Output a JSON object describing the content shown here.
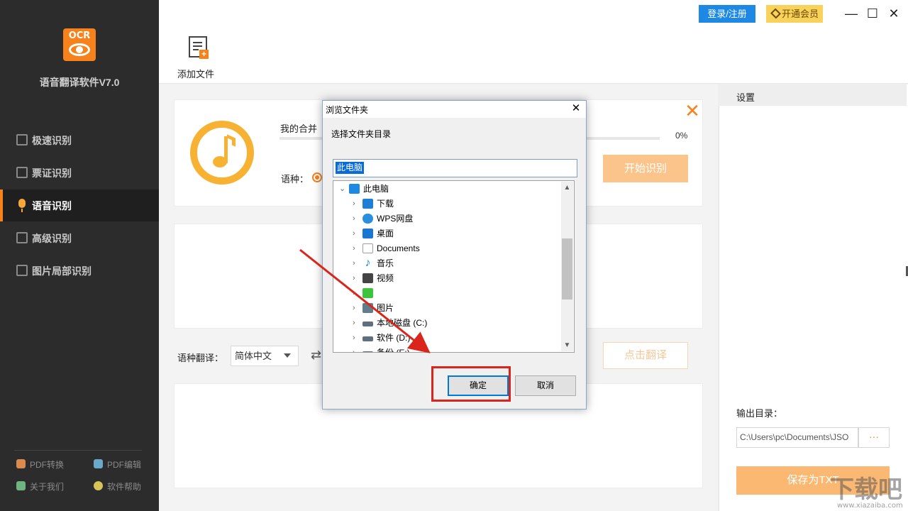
{
  "app": {
    "logo_text": "OCR",
    "title": "语音翻译软件V7.0"
  },
  "sidebar": {
    "items": [
      {
        "label": "极速识别",
        "active": false
      },
      {
        "label": "票证识别",
        "active": false
      },
      {
        "label": "语音识别",
        "active": true
      },
      {
        "label": "高级识别",
        "active": false
      },
      {
        "label": "图片局部识别",
        "active": false
      }
    ],
    "footer_links": [
      {
        "label": "PDF转换",
        "icon": "pdf-convert-icon",
        "color": "#d98a4e"
      },
      {
        "label": "PDF编辑",
        "icon": "pdf-edit-icon",
        "color": "#6aa9c9"
      },
      {
        "label": "关于我们",
        "icon": "about-icon",
        "color": "#6fb57f"
      },
      {
        "label": "软件帮助",
        "icon": "help-icon",
        "color": "#d7c35a"
      }
    ]
  },
  "topbar": {
    "login_label": "登录/注册",
    "vip_label": "开通会员",
    "minimize": "—",
    "maximize": "☐",
    "close": "✕"
  },
  "toolbar": {
    "add_file_label": "添加文件"
  },
  "main": {
    "file_name": "我的合并",
    "progress_pct": "0%",
    "progress_value": 0,
    "language_label": "语种：",
    "start_button": "开始识别",
    "translate_label": "语种翻译：",
    "translate_source": "简体中文",
    "translate_button": "点击翻译"
  },
  "right_panel": {
    "settings_title": "设置",
    "output_label": "输出目录：",
    "output_path": "C:\\Users\\pc\\Documents\\JSO",
    "browse_label": "···",
    "save_button": "保存为TXT"
  },
  "dialog": {
    "title": "浏览文件夹",
    "close": "✕",
    "instruction": "选择文件夹目录",
    "input_value": "此电脑",
    "tree": [
      {
        "label": "此电脑",
        "level": 0,
        "expanded": true,
        "icon": "computer-icon",
        "color": "#1e88e5"
      },
      {
        "label": "下载",
        "level": 1,
        "icon": "download-icon",
        "color": "#1e7fd6"
      },
      {
        "label": "WPS网盘",
        "level": 1,
        "icon": "cloud-icon",
        "color": "#2a8fe0"
      },
      {
        "label": "桌面",
        "level": 1,
        "icon": "desktop-icon",
        "color": "#1976d2"
      },
      {
        "label": "Documents",
        "level": 1,
        "icon": "documents-icon",
        "color": "#9e9e9e"
      },
      {
        "label": "音乐",
        "level": 1,
        "icon": "music-icon",
        "color": "#1e88e5"
      },
      {
        "label": "视频",
        "level": 1,
        "icon": "video-icon",
        "color": "#444444"
      },
      {
        "label": "",
        "level": 1,
        "icon": "app-folder-icon",
        "color": "#3cc43c"
      },
      {
        "label": "图片",
        "level": 1,
        "icon": "pictures-icon",
        "color": "#607d8b"
      },
      {
        "label": "本地磁盘 (C:)",
        "level": 1,
        "icon": "drive-c-icon",
        "color": "#5f6f7f"
      },
      {
        "label": "软件 (D:)",
        "level": 1,
        "icon": "drive-d-icon",
        "color": "#5f6f7f"
      },
      {
        "label": "备份 (E:)",
        "level": 1,
        "icon": "drive-e-icon",
        "color": "#5f6f7f"
      }
    ],
    "ok_button": "确定",
    "cancel_button": "取消"
  },
  "watermark": {
    "brand": "下载吧",
    "url": "www.xiazaiba.com"
  },
  "colors": {
    "accent": "#f7821b",
    "annotation": "#d9251c",
    "login_blue": "#1e88e5",
    "vip_yellow": "#f8d25a"
  }
}
